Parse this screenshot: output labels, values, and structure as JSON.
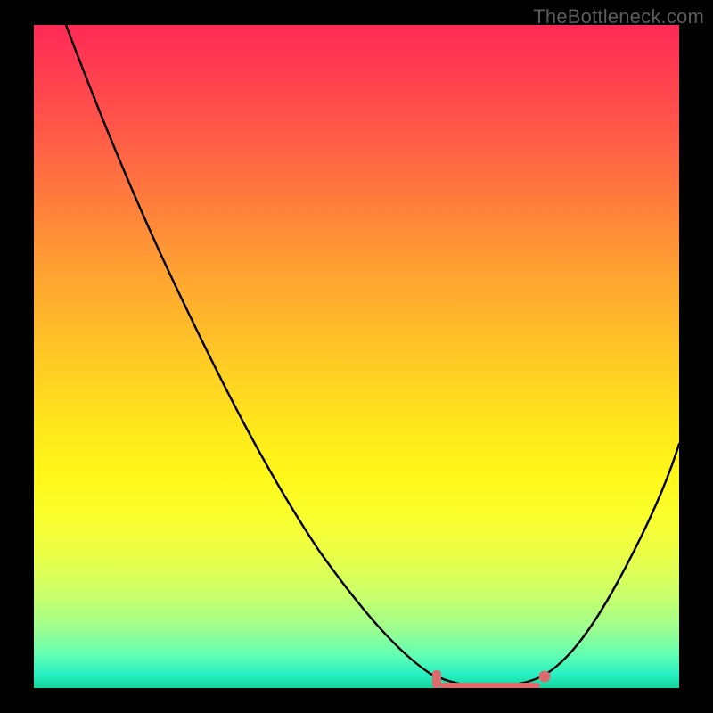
{
  "watermark": "TheBottleneck.com",
  "colors": {
    "background": "#000000",
    "gradient_top": "#ff2a56",
    "gradient_bottom": "#17d49a",
    "curve": "#000000",
    "marker": "#e06a6b"
  },
  "chart_data": {
    "type": "line",
    "title": "",
    "xlabel": "",
    "ylabel": "",
    "xlim": [
      0,
      100
    ],
    "ylim": [
      0,
      100
    ],
    "x": [
      0,
      5,
      10,
      15,
      20,
      25,
      30,
      35,
      40,
      45,
      50,
      55,
      60,
      63,
      66,
      69,
      72,
      75,
      78,
      80,
      85,
      90,
      95,
      100
    ],
    "values": [
      100,
      93,
      84,
      75,
      66,
      57,
      48,
      40,
      32,
      24,
      17,
      11,
      6,
      3,
      1,
      0,
      0,
      0,
      0.5,
      2,
      9,
      18,
      28,
      38
    ],
    "markers": {
      "bar": {
        "x_start": 62,
        "x_end": 66,
        "y": 1.5
      },
      "dot": {
        "x": 79.5,
        "y": 2
      }
    },
    "notes": "V-shaped bottleneck curve on a vertical red-to-green gradient; minimum near x≈70."
  }
}
